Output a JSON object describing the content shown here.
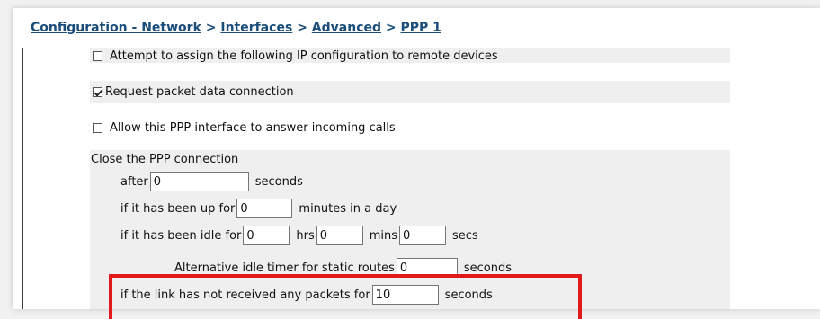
{
  "breadcrumb": {
    "items": [
      "Configuration - Network",
      "Interfaces",
      "Advanced",
      "PPP 1"
    ],
    "separator": ">"
  },
  "options": {
    "assign_ip": {
      "label": "Attempt to assign the following IP configuration to remote devices",
      "checked": false
    },
    "packet_data": {
      "label": "Request packet data connection",
      "checked": true
    },
    "answer_calls": {
      "label": "Allow this PPP interface to answer incoming calls",
      "checked": false
    }
  },
  "close": {
    "heading": "Close the PPP connection",
    "after": {
      "label": "after",
      "value": "0",
      "unit": "seconds"
    },
    "up_for": {
      "label": "if it has been up for",
      "value": "0",
      "unit": "minutes in a day"
    },
    "idle_for": {
      "label": "if it has been idle for",
      "hrs_value": "0",
      "hrs_label": "hrs",
      "mins_value": "0",
      "mins_label": "mins",
      "secs_value": "0",
      "secs_label": "secs"
    },
    "alt_idle": {
      "label": "Alternative idle timer for static routes",
      "value": "0",
      "unit": "seconds"
    },
    "no_packets": {
      "label": "if the link has not received any packets for",
      "value": "10",
      "unit": "seconds"
    }
  },
  "colors": {
    "link": "#1a4d7a",
    "highlight": "#e01a1a",
    "band": "#efefef"
  }
}
